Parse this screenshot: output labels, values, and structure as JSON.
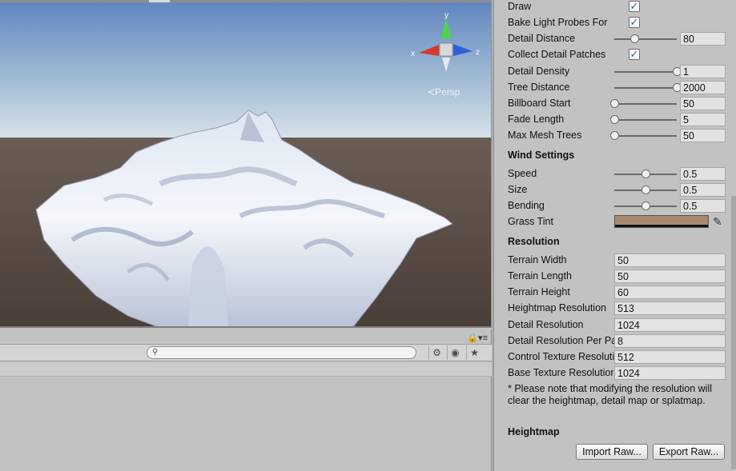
{
  "scene": {
    "persp_label": "≺Persp",
    "gizmo": {
      "x": "x",
      "y": "y",
      "z": "z"
    }
  },
  "search": {
    "placeholder": ""
  },
  "inspector": {
    "rows": [
      {
        "label": "Draw",
        "type": "checkbox",
        "checked": true
      },
      {
        "label": "Bake Light Probes For",
        "type": "checkbox",
        "checked": true
      },
      {
        "label": "Detail Distance",
        "type": "slider",
        "fraction": 0.33,
        "value": "80"
      },
      {
        "label": "Collect Detail Patches",
        "type": "checkbox",
        "checked": true
      },
      {
        "label": "Detail Density",
        "type": "slider",
        "fraction": 1.0,
        "value": "1"
      },
      {
        "label": "Tree Distance",
        "type": "slider",
        "fraction": 1.0,
        "value": "2000"
      },
      {
        "label": "Billboard Start",
        "type": "slider",
        "fraction": 0.0,
        "value": "50"
      },
      {
        "label": "Fade Length",
        "type": "slider",
        "fraction": 0.0,
        "value": "5"
      },
      {
        "label": "Max Mesh Trees",
        "type": "slider",
        "fraction": 0.0,
        "value": "50"
      }
    ],
    "wind": {
      "title": "Wind Settings",
      "speed": {
        "label": "Speed",
        "fraction": 0.5,
        "value": "0.5"
      },
      "size": {
        "label": "Size",
        "fraction": 0.5,
        "value": "0.5"
      },
      "bending": {
        "label": "Bending",
        "fraction": 0.5,
        "value": "0.5"
      },
      "grass_tint": {
        "label": "Grass Tint",
        "color": "#a98a6f"
      }
    },
    "resolution": {
      "title": "Resolution",
      "fields": [
        {
          "label": "Terrain Width",
          "value": "50"
        },
        {
          "label": "Terrain Length",
          "value": "50"
        },
        {
          "label": "Terrain Height",
          "value": "60"
        },
        {
          "label": "Heightmap Resolution",
          "value": "513"
        },
        {
          "label": "Detail Resolution",
          "value": "1024"
        },
        {
          "label": "Detail Resolution Per Patch",
          "value": "8"
        },
        {
          "label": "Control Texture Resolution",
          "value": "512"
        },
        {
          "label": "Base Texture Resolution",
          "value": "1024"
        }
      ],
      "note": "* Please note that modifying the resolution will clear the heightmap, detail map or splatmap."
    },
    "heightmap": {
      "title": "Heightmap",
      "import_label": "Import Raw...",
      "export_label": "Export Raw..."
    }
  }
}
